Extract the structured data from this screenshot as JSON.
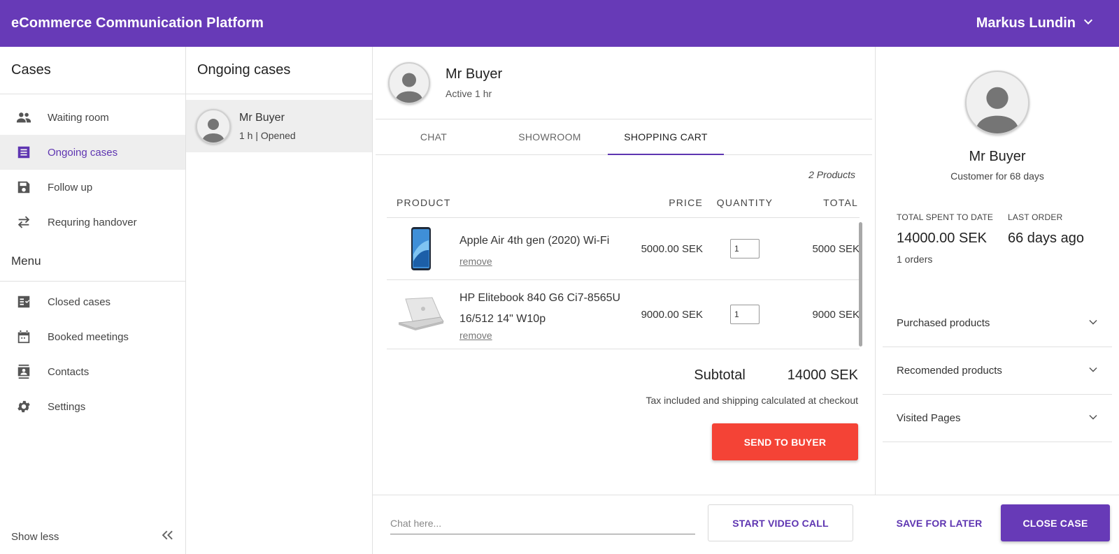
{
  "app": {
    "title": "eCommerce Communication Platform",
    "user_name": "Markus Lundin",
    "brand_color": "#673ab7",
    "accent_color": "#f44336"
  },
  "sidebar": {
    "cases_title": "Cases",
    "case_items": [
      {
        "label": "Waiting room",
        "icon": "people-icon"
      },
      {
        "label": "Ongoing cases",
        "icon": "list-icon",
        "active": true
      },
      {
        "label": "Follow up",
        "icon": "save-icon"
      },
      {
        "label": "Requring handover",
        "icon": "swap-icon"
      }
    ],
    "menu_title": "Menu",
    "menu_items": [
      {
        "label": "Closed cases",
        "icon": "checklist-icon"
      },
      {
        "label": "Booked meetings",
        "icon": "calendar-icon"
      },
      {
        "label": "Contacts",
        "icon": "contacts-icon"
      },
      {
        "label": "Settings",
        "icon": "gear-icon"
      }
    ],
    "show_less": "Show less"
  },
  "ongoing": {
    "title": "Ongoing cases",
    "cases": [
      {
        "name": "Mr Buyer",
        "meta": "1 h | Opened"
      }
    ]
  },
  "main": {
    "buyer_name": "Mr Buyer",
    "buyer_status": "Active 1 hr",
    "tabs": [
      {
        "label": "CHAT"
      },
      {
        "label": "SHOWROOM"
      },
      {
        "label": "SHOPPING CART",
        "active": true
      }
    ],
    "cart": {
      "count_label": "2 Products",
      "columns": {
        "product": "PRODUCT",
        "price": "PRICE",
        "quantity": "QUANTITY",
        "total": "TOTAL"
      },
      "rows": [
        {
          "name": "Apple Air 4th gen (2020) Wi-Fi",
          "price": "5000.00 SEK",
          "quantity": "1",
          "total": "5000 SEK",
          "remove": "remove"
        },
        {
          "name": "HP Elitebook 840 G6 Ci7-8565U 16/512 14\" W10p",
          "price": "9000.00 SEK",
          "quantity": "1",
          "total": "9000 SEK",
          "remove": "remove"
        }
      ],
      "subtotal_label": "Subtotal",
      "subtotal_value": "14000 SEK",
      "tax_note": "Tax included and shipping calculated at checkout",
      "send_label": "SEND TO BUYER"
    }
  },
  "customer": {
    "name": "Mr Buyer",
    "since": "Customer for 68 days",
    "total_spent_label": "TOTAL SPENT TO DATE",
    "total_spent_value": "14000.00 SEK",
    "orders": "1 orders",
    "last_order_label": "LAST ORDER",
    "last_order_value": "66 days ago",
    "sections": [
      {
        "label": "Purchased products"
      },
      {
        "label": "Recomended products"
      },
      {
        "label": "Visited Pages"
      }
    ]
  },
  "bottombar": {
    "chat_placeholder": "Chat here...",
    "video_label": "START VIDEO CALL",
    "save_label": "SAVE FOR LATER",
    "close_label": "CLOSE CASE"
  }
}
